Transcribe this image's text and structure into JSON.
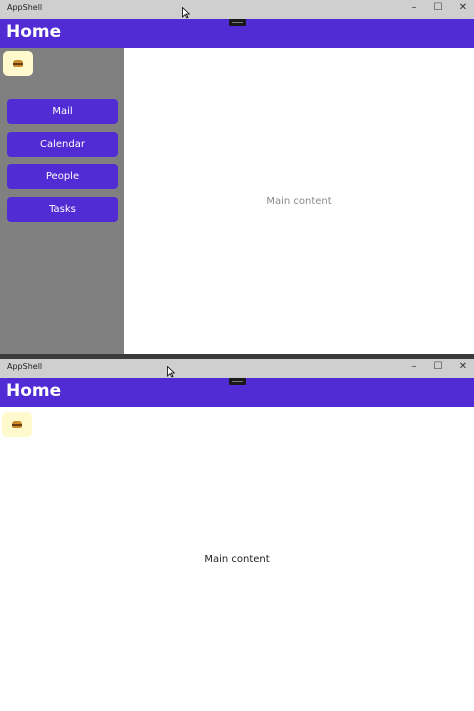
{
  "window": {
    "title": "AppShell",
    "controls": {
      "minimize": "–",
      "maximize": "☐",
      "close": "✕"
    }
  },
  "header": {
    "title": "Home"
  },
  "menu_button": {
    "icon": "hamburger-icon"
  },
  "nav": {
    "items": [
      {
        "label": "Mail"
      },
      {
        "label": "Calendar"
      },
      {
        "label": "People"
      },
      {
        "label": "Tasks"
      }
    ]
  },
  "main": {
    "text": "Main content"
  },
  "colors": {
    "accent": "#512bd4",
    "titlebar": "#cfcfcf",
    "sidebar": "#808080",
    "menu_button_bg": "#fffacd"
  }
}
